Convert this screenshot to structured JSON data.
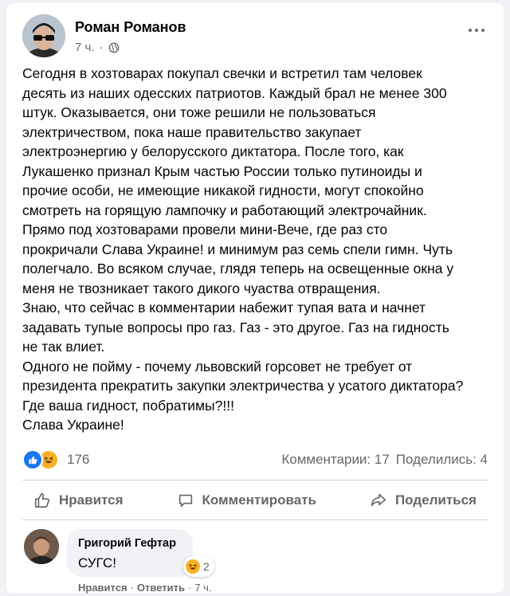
{
  "post": {
    "author": "Роман Романов",
    "time": "7 ч.",
    "separator": "·",
    "lines": [
      "Сегодня в хозтоварах покупал свечки и встретил там человек",
      "десять из наших одесских патриотов.  Каждый брал не менее 300",
      "штук. Оказывается, они тоже решили не пользоваться",
      "электричеством, пока наше правительство закупает",
      "электроэнергию у белорусского диктатора. После того, как",
      "Лукашенко признал Крым частью России только путиноиды и",
      "прочие особи, не имеющие никакой гидности, могут спокойно",
      "смотреть на горящую лампочку и работающий электрочайник.",
      "Прямо под хозтоварами провели мини-Вече, где раз сто",
      "прокричали Слава Украине! и минимум раз семь спели гимн. Чуть",
      "полегчало. Во всяком случае, глядя теперь на освещенные окна у",
      "меня не твозникает такого дикого чуаства отвращения.",
      "Знаю, что сейчас в комментарии набежит тупая вата и начнет",
      "задавать тупые вопросы про газ. Газ - это другое.  Газ на гидность",
      "не так влиет.",
      "Одного не пойму - почему львовский горсовет не требует от",
      "президента прекратить закупки электричества у усатого диктатора?",
      "Где ваша гидност, побратимы?!!!",
      "Слава Украине!"
    ]
  },
  "reactions": {
    "count": "176",
    "icons": [
      "like-icon",
      "haha-icon"
    ]
  },
  "stats": {
    "comments": "Комментарии: 17",
    "shares": "Поделились: 4"
  },
  "actions": {
    "like": "Нравится",
    "comment": "Комментировать",
    "share": "Поделиться"
  },
  "comment": {
    "author": "Григорий Гефтар",
    "text": "СУГС!",
    "reaction_count": "2",
    "like": "Нравится",
    "reply": "Ответить",
    "time": "7 ч.",
    "dot": "·"
  },
  "colors": {
    "accent": "#1877f2",
    "haha": "#f7b125",
    "muted": "#65676b"
  }
}
